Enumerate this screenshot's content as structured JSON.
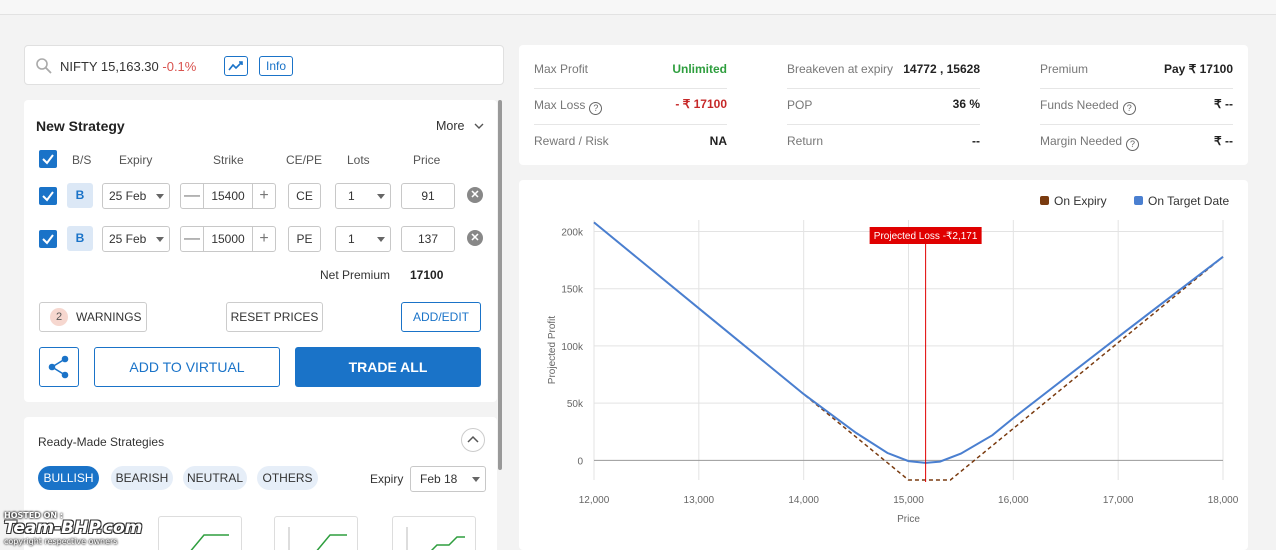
{
  "search": {
    "symbol": "NIFTY 15,163.30",
    "change": "-0.1%",
    "info_label": "Info"
  },
  "strategy": {
    "title": "New Strategy",
    "more_label": "More",
    "headers": {
      "bs": "B/S",
      "expiry": "Expiry",
      "strike": "Strike",
      "cepe": "CE/PE",
      "lots": "Lots",
      "price": "Price"
    },
    "legs": [
      {
        "bs": "B",
        "expiry": "25 Feb",
        "strike": "15400",
        "type": "CE",
        "lots": "1",
        "price": "91"
      },
      {
        "bs": "B",
        "expiry": "25 Feb",
        "strike": "15000",
        "type": "PE",
        "lots": "1",
        "price": "137"
      }
    ],
    "net_premium_label": "Net Premium",
    "net_premium_value": "17100",
    "warnings_count": "2",
    "warnings_label": "WARNINGS",
    "reset_label": "RESET PRICES",
    "addedit_label": "ADD/EDIT",
    "add_virtual_label": "ADD TO VIRTUAL",
    "trade_all_label": "TRADE ALL"
  },
  "readymade": {
    "title": "Ready-Made Strategies",
    "filters": [
      "BULLISH",
      "BEARISH",
      "NEUTRAL",
      "OTHERS"
    ],
    "active_filter": "BULLISH",
    "expiry_label": "Expiry",
    "expiry_value": "Feb 18"
  },
  "summary": {
    "max_profit_label": "Max Profit",
    "max_profit_value": "Unlimited",
    "max_loss_label": "Max Loss",
    "max_loss_value": "- ₹ 17100",
    "reward_risk_label": "Reward / Risk",
    "reward_risk_value": "NA",
    "breakeven_label": "Breakeven at expiry",
    "breakeven_value": "14772 , 15628",
    "pop_label": "POP",
    "pop_value": "36 %",
    "return_label": "Return",
    "return_value": "--",
    "premium_label": "Premium",
    "premium_value": "Pay ₹ 17100",
    "funds_label": "Funds Needed",
    "funds_value": "₹ --",
    "margin_label": "Margin Needed",
    "margin_value": "₹ --"
  },
  "colors": {
    "accent": "#1a73c8",
    "profit": "#2e9e3e",
    "loss": "#c62828",
    "expiry_line": "#7a3b10",
    "target_line": "#4a7fd0",
    "marker": "#e00000"
  },
  "watermark": {
    "line1": "HOSTED ON :",
    "line2": "Team-BHP.com",
    "line3": "copyright respective owners"
  },
  "chart_data": {
    "type": "line",
    "xlabel": "Price",
    "ylabel": "Projected Profit",
    "xlim": [
      12000,
      18000
    ],
    "ylim": [
      -17100,
      210000
    ],
    "x_ticks": [
      "12,000",
      "13,000",
      "14,000",
      "15,000",
      "16,000",
      "17,000",
      "18,000"
    ],
    "y_ticks": [
      "0",
      "50k",
      "100k",
      "150k",
      "200k"
    ],
    "y_tick_values": [
      0,
      50000,
      100000,
      150000,
      200000
    ],
    "x_tick_values": [
      12000,
      13000,
      14000,
      15000,
      16000,
      17000,
      18000
    ],
    "legend_position": "top-right",
    "annotation": {
      "label": "Projected Loss -₹2,171",
      "x": 15163.3
    },
    "series": [
      {
        "name": "On Expiry",
        "style": "dashed",
        "x": [
          12000,
          15000,
          15400,
          18000
        ],
        "y": [
          207900,
          -17100,
          -17100,
          177900
        ]
      },
      {
        "name": "On Target Date",
        "style": "solid",
        "x": [
          12000,
          13000,
          14000,
          14500,
          14800,
          15000,
          15163.3,
          15300,
          15500,
          15800,
          16000,
          17000,
          18000
        ],
        "y": [
          207900,
          132900,
          57900,
          24000,
          6500,
          -600,
          -2171,
          -1000,
          6000,
          22000,
          37000,
          107900,
          177900
        ]
      }
    ]
  }
}
